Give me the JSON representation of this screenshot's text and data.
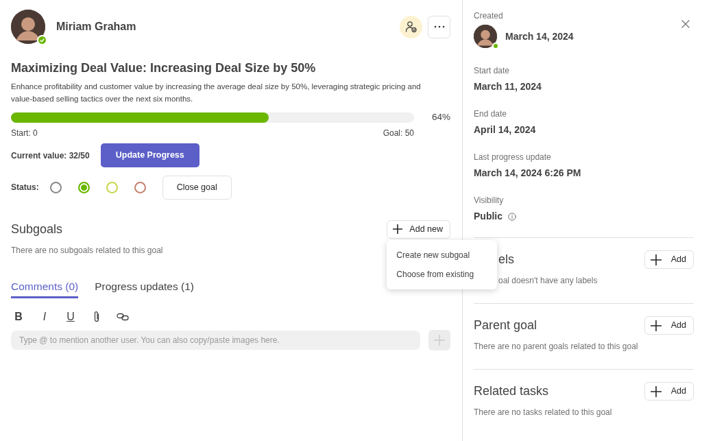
{
  "owner": {
    "name": "Miriam Graham",
    "online": true
  },
  "goal": {
    "title": "Maximizing Deal Value: Increasing Deal Size by 50%",
    "description": "Enhance profitability and customer value by increasing the average deal size by 50%, leveraging strategic pricing and value-based selling tactics over the next six months.",
    "progress": {
      "level": 0.64,
      "percent": "64%",
      "start": "Start: 0",
      "goal": "Goal: 50"
    },
    "current_value": "Current value: 32/50",
    "update_button": "Update Progress",
    "status_label": "Status:",
    "statuses": [
      {
        "color": "#8a8886",
        "selected": false
      },
      {
        "color": "#6bb700",
        "selected": true
      },
      {
        "color": "#c8d64a",
        "selected": false
      },
      {
        "color": "#c4816e",
        "selected": false
      }
    ],
    "close_button": "Close goal"
  },
  "subgoals": {
    "title": "Subgoals",
    "add_button": "Add new",
    "empty": "There are no subgoals related to this goal",
    "menu": [
      "Create new subgoal",
      "Choose from existing"
    ]
  },
  "tabs": [
    {
      "label": "Comments (0)",
      "selected": true
    },
    {
      "label": "Progress updates (1)",
      "selected": false
    }
  ],
  "editor": {
    "toolbar": [
      {
        "kind": "bold",
        "glyph": "B"
      },
      {
        "kind": "italic",
        "glyph": "I"
      },
      {
        "kind": "underline",
        "glyph": "U"
      },
      {
        "kind": "attach"
      },
      {
        "kind": "link"
      }
    ],
    "placeholder": "Type @ to mention another user. You can also copy/paste images here."
  },
  "details": [
    {
      "label": "Created",
      "value": "March 14, 2024",
      "avatar": true
    },
    {
      "label": "Start date",
      "value": "March 11, 2024"
    },
    {
      "label": "End date",
      "value": "April 14, 2024"
    },
    {
      "label": "Last progress update",
      "value": "March 14, 2024 6:26 PM"
    },
    {
      "label": "Visibility",
      "value": "Public",
      "info": true
    }
  ],
  "sections": [
    {
      "title": "els",
      "text": "oal doesn't have any labels",
      "add_button": "Add",
      "partly_hidden": true
    },
    {
      "title": "Parent goal",
      "text": "There are no parent goals related to this goal",
      "add_button": "Add"
    },
    {
      "title": "Related tasks",
      "text": "There are no tasks related to this goal",
      "add_button": "Add"
    }
  ]
}
